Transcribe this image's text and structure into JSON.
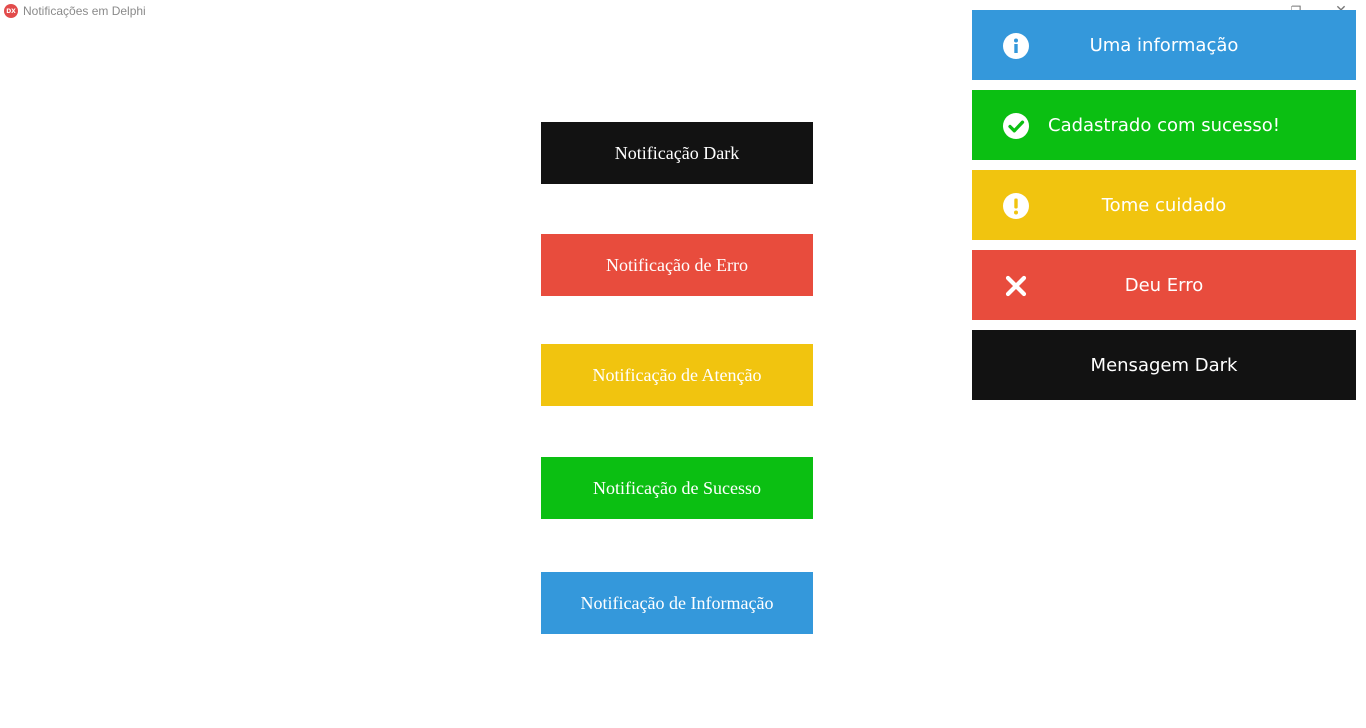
{
  "window": {
    "title": "Notificações em Delphi",
    "app_icon_text": "DX",
    "restore_glyph": "❐",
    "close_glyph": "✕"
  },
  "buttons": [
    {
      "label": "Notificação Dark",
      "color": "#121212"
    },
    {
      "label": "Notificação de Erro",
      "color": "#e84c3d"
    },
    {
      "label": "Notificação de Atenção",
      "color": "#f1c40f"
    },
    {
      "label": "Notificação de Sucesso",
      "color": "#0bbf12"
    },
    {
      "label": "Notificação de Informação",
      "color": "#3498db"
    }
  ],
  "toasts": [
    {
      "text": "Uma informação",
      "icon": "info-circle-icon",
      "color": "#3498db"
    },
    {
      "text": "Cadastrado com sucesso!",
      "icon": "check-circle-icon",
      "color": "#0bbf12"
    },
    {
      "text": "Tome cuidado",
      "icon": "exclamation-circle-icon",
      "color": "#f1c40f"
    },
    {
      "text": "Deu Erro",
      "icon": "x-icon",
      "color": "#e84c3d"
    },
    {
      "text": "Mensagem Dark",
      "icon": "",
      "color": "#121212"
    }
  ]
}
